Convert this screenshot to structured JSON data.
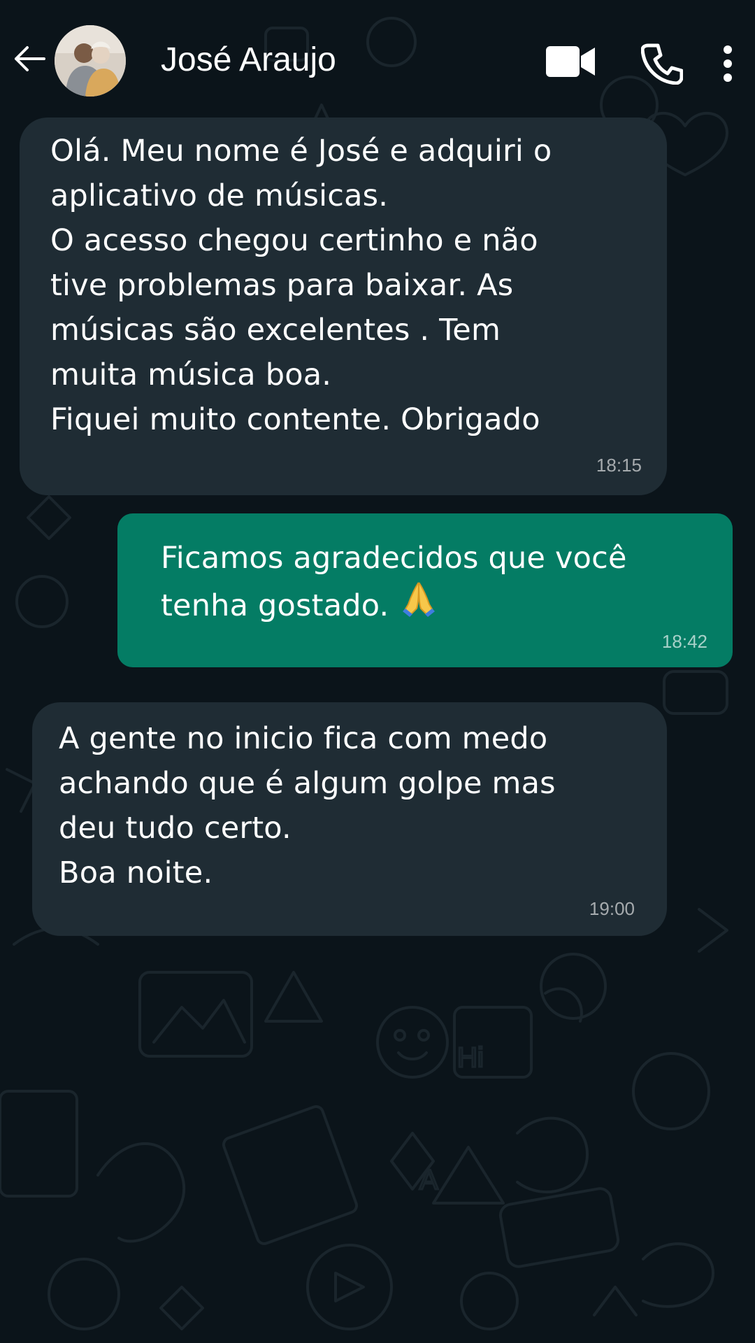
{
  "header": {
    "contact_name": "José Araujo",
    "back_icon": "arrow-left-icon",
    "video_icon": "video-camera-icon",
    "call_icon": "phone-icon",
    "menu_icon": "more-vertical-icon"
  },
  "messages": [
    {
      "direction": "incoming",
      "text": "Olá. Meu nome é José e adquiri o\naplicativo de músicas.\nO acesso chegou certinho e não\ntive problemas para baixar. As\nmúsicas são excelentes . Tem\nmuita música boa.\nFiquei muito contente. Obrigado",
      "time": "18:15"
    },
    {
      "direction": "outgoing",
      "text": "Ficamos agradecidos que você\ntenha gostado.",
      "emoji": "folded-hands-icon",
      "time": "18:42"
    },
    {
      "direction": "incoming",
      "text": "A gente no inicio fica com medo\nachando que é algum golpe mas\ndeu tudo certo.\nBoa noite.",
      "time": "19:00"
    }
  ],
  "colors": {
    "background": "#0b141a",
    "incoming_bubble": "#1f2c34",
    "outgoing_bubble": "#047c64",
    "text": "#ffffff"
  }
}
